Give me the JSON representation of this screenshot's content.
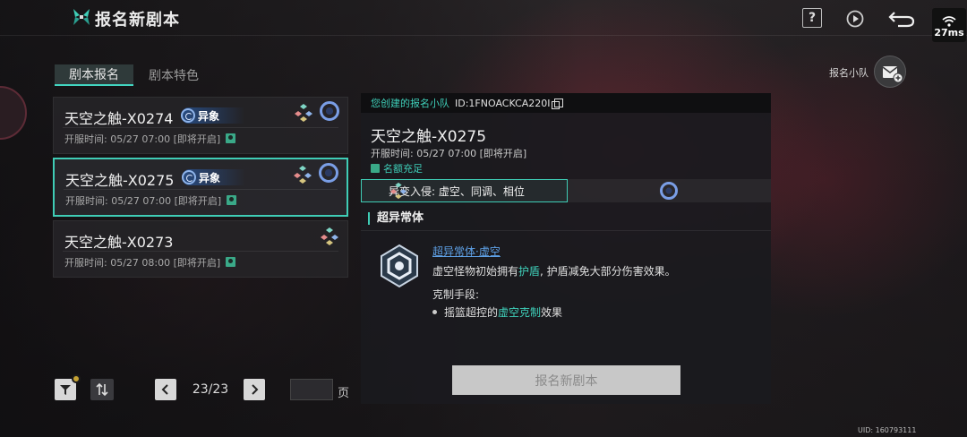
{
  "header": {
    "title": "报名新剧本",
    "ping": "27ms"
  },
  "tabs": [
    {
      "label": "剧本报名",
      "active": true
    },
    {
      "label": "剧本特色",
      "active": false
    }
  ],
  "list": [
    {
      "name": "天空之触-X0274",
      "tag": "异象",
      "time": "开服时间: 05/27 07:00 [即将开启]"
    },
    {
      "name": "天空之触-X0275",
      "tag": "异象",
      "time": "开服时间: 05/27 07:00 [即将开启]",
      "selected": true
    },
    {
      "name": "天空之触-X0273",
      "tag": "",
      "time": "开服时间: 05/27 08:00 [即将开启]"
    }
  ],
  "pagination": {
    "label": "23/23",
    "unit": "页",
    "input_value": ""
  },
  "detail": {
    "head_label": "您创建的报名小队",
    "head_id": "ID:1FNOACKCA220I",
    "name": "天空之触-X0275",
    "time": "开服时间: 05/27 07:00   [即将开启]",
    "quota": "名额充足",
    "invasion": "异变入侵: 虚空、同调、相位",
    "section_title": "超异常体",
    "ability_name": "超异常体·虚空",
    "ability_desc_pre": "虚空怪物初始拥有",
    "ability_desc_hl": "护盾",
    "ability_desc_post": ", 护盾减免大部分伤害效果。",
    "counter_label": "克制手段:",
    "counter_pre": "摇篮超控的",
    "counter_hl": "虚空克制",
    "counter_post": "效果",
    "submit_label": "报名新剧本"
  },
  "team_label": "报名小队",
  "uid": "UID: 160793111",
  "colors": {
    "accent": "#3fcdb6",
    "link": "#5fa2e8",
    "bg": "#1c1b1e"
  }
}
